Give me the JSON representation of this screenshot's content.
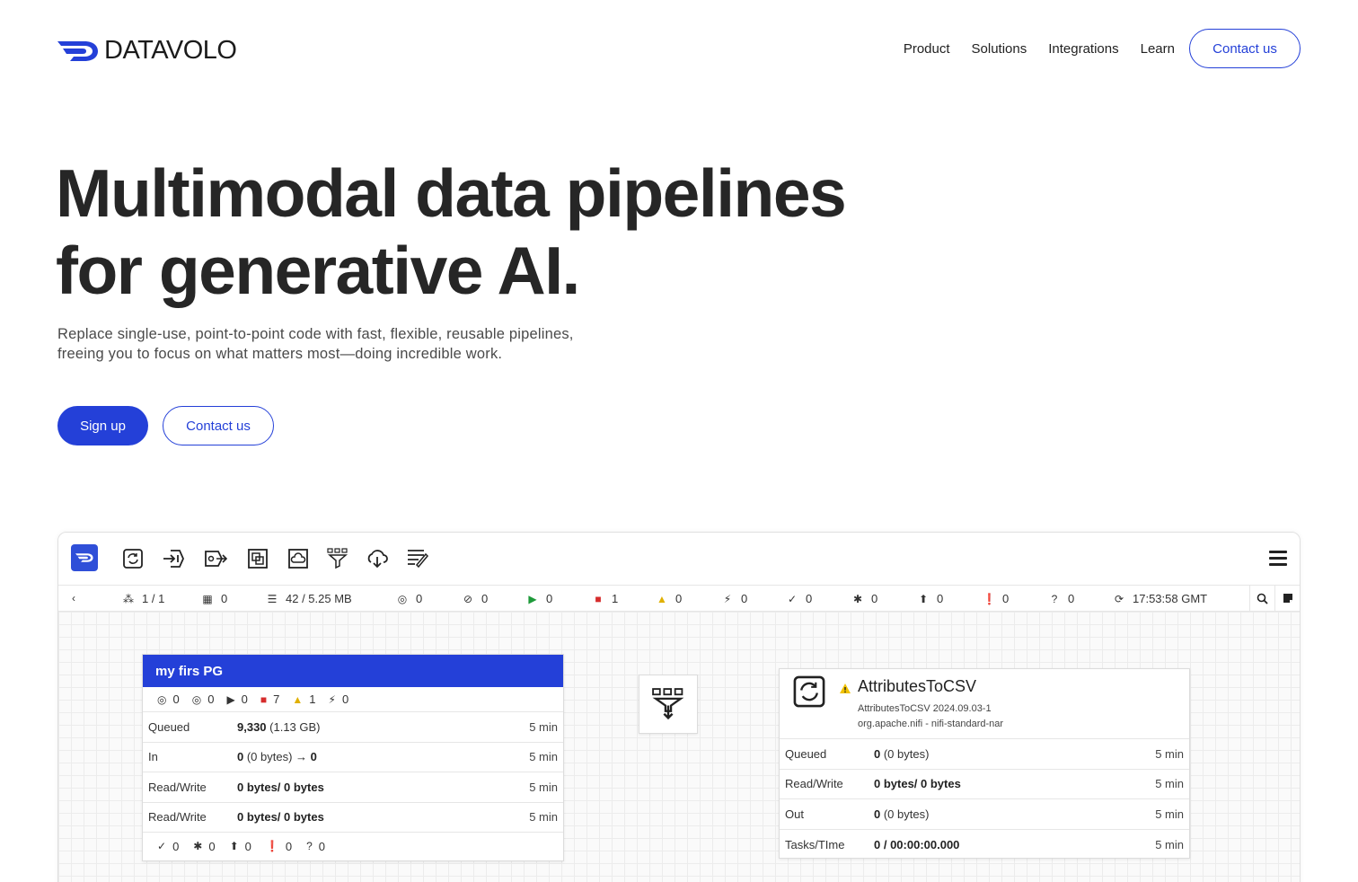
{
  "nav": {
    "logo_text": "DATAVOLO",
    "links": [
      "Product",
      "Solutions",
      "Integrations",
      "Learn"
    ],
    "cta": "Contact us"
  },
  "hero": {
    "title_line1": "Multimodal data pipelines",
    "title_line2": "for generative AI.",
    "subtitle_line1": "Replace single-use, point-to-point code with fast, flexible, reusable pipelines,",
    "subtitle_line2": "freeing you to focus on what matters most—doing incredible work.",
    "primary_button": "Sign up",
    "secondary_button": "Contact us"
  },
  "app": {
    "status_bar": {
      "threads": "1 / 1",
      "components": "0",
      "queued": "42 / 5.25 MB",
      "transmitting": "0",
      "not_transmitting": "0",
      "running": "0",
      "stopped": "1",
      "invalid": "0",
      "disabled": "0",
      "up_to_date": "0",
      "locally_modified": "0",
      "stale": "0",
      "sync_failure": "0",
      "unknown": "0",
      "refreshed": "17:53:58 GMT"
    },
    "process_group": {
      "name": "my firs PG",
      "stats": {
        "transmitting": "0",
        "not_transmitting": "0",
        "running": "0",
        "stopped": "7",
        "invalid": "1",
        "disabled": "0"
      },
      "rows": [
        {
          "label": "Queued",
          "value_bold": "9,330",
          "value_rest": " (1.13 GB)",
          "time": "5 min"
        },
        {
          "label": "In",
          "value_bold": "0",
          "value_rest": " (0 bytes) ",
          "value_arrow": "→ 0",
          "time": "5 min"
        },
        {
          "label": "Read/Write",
          "value_bold": "0 bytes/ 0 bytes",
          "value_rest": "",
          "time": "5 min"
        },
        {
          "label": "Read/Write",
          "value_bold": "0 bytes/ 0 bytes",
          "value_rest": "",
          "time": "5 min"
        }
      ],
      "footer": {
        "up_to_date": "0",
        "locally_modified": "0",
        "stale": "0",
        "sync_failure": "0",
        "unknown": "0"
      }
    },
    "processor": {
      "name": "AttributesToCSV",
      "type": "AttributesToCSV 2024.09.03-1",
      "bundle": "org.apache.nifi - nifi-standard-nar",
      "rows": [
        {
          "label": "Queued",
          "value_bold": "0",
          "value_rest": " (0 bytes)",
          "time": "5 min"
        },
        {
          "label": "Read/Write",
          "value_bold": "0 bytes/ 0 bytes",
          "value_rest": "",
          "time": "5 min"
        },
        {
          "label": "Out",
          "value_bold": "0",
          "value_rest": " (0 bytes)",
          "time": "5 min"
        },
        {
          "label": "Tasks/TIme",
          "value_bold": "0 / 00:00:00.000",
          "value_rest": "",
          "time": "5 min"
        }
      ]
    }
  },
  "colors": {
    "brand": "#2440d8",
    "running": "#1e9a3a",
    "stopped": "#d62c2c",
    "warning": "#f2c300"
  }
}
